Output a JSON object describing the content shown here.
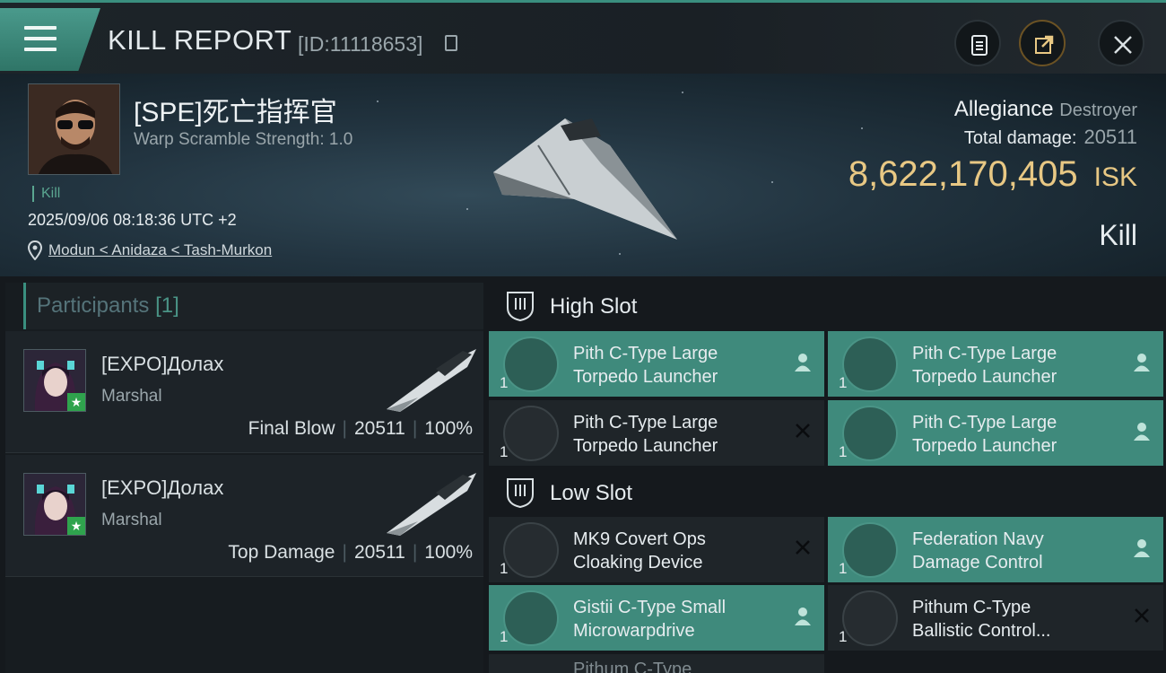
{
  "header": {
    "title": "KILL REPORT",
    "report_id": "[ID:11118653]"
  },
  "victim": {
    "name": "[SPE]死亡指挥官",
    "warp_scramble": "Warp Scramble Strength: 1.0",
    "tag": "Kill",
    "datetime": "2025/09/06 08:18:36 UTC +2",
    "location": "Modun < Anidaza < Tash-Murkon",
    "ship_name": "Allegiance",
    "ship_class": "Destroyer",
    "total_damage_label": "Total damage:",
    "total_damage": "20511",
    "isk_value": "8,622,170,405",
    "isk_unit": "ISK",
    "outcome": "Kill"
  },
  "participants": {
    "title": "Participants",
    "count": "[1]",
    "list": [
      {
        "name": "[EXPO]Долах",
        "rank": "Marshal",
        "role": "Final Blow",
        "damage": "20511",
        "percent": "100%"
      },
      {
        "name": "[EXPO]Долах",
        "rank": "Marshal",
        "role": "Top Damage",
        "damage": "20511",
        "percent": "100%"
      }
    ]
  },
  "slots": {
    "high_label": "High Slot",
    "low_label": "Low Slot",
    "high": [
      {
        "qty": "1",
        "line1": "Pith C-Type Large",
        "line2": "Torpedo Launcher",
        "status": "dropped"
      },
      {
        "qty": "1",
        "line1": "Pith C-Type Large",
        "line2": "Torpedo Launcher",
        "status": "dropped"
      },
      {
        "qty": "1",
        "line1": "Pith C-Type Large",
        "line2": "Torpedo Launcher",
        "status": "destroyed"
      },
      {
        "qty": "1",
        "line1": "Pith C-Type Large",
        "line2": "Torpedo Launcher",
        "status": "dropped"
      }
    ],
    "low": [
      {
        "qty": "1",
        "line1": "MK9 Covert Ops",
        "line2": "Cloaking Device",
        "status": "destroyed"
      },
      {
        "qty": "1",
        "line1": "Federation Navy",
        "line2": "Damage Control",
        "status": "dropped"
      },
      {
        "qty": "1",
        "line1": "Gistii C-Type Small",
        "line2": "Microwarpdrive",
        "status": "dropped"
      },
      {
        "qty": "1",
        "line1": "Pithum C-Type",
        "line2": "Ballistic Control...",
        "status": "destroyed"
      }
    ],
    "partial_next": "Pithum C-Type"
  },
  "colors": {
    "accent": "#3f8a7c",
    "isk_gold": "#e8c884",
    "panel": "#1f2529"
  }
}
